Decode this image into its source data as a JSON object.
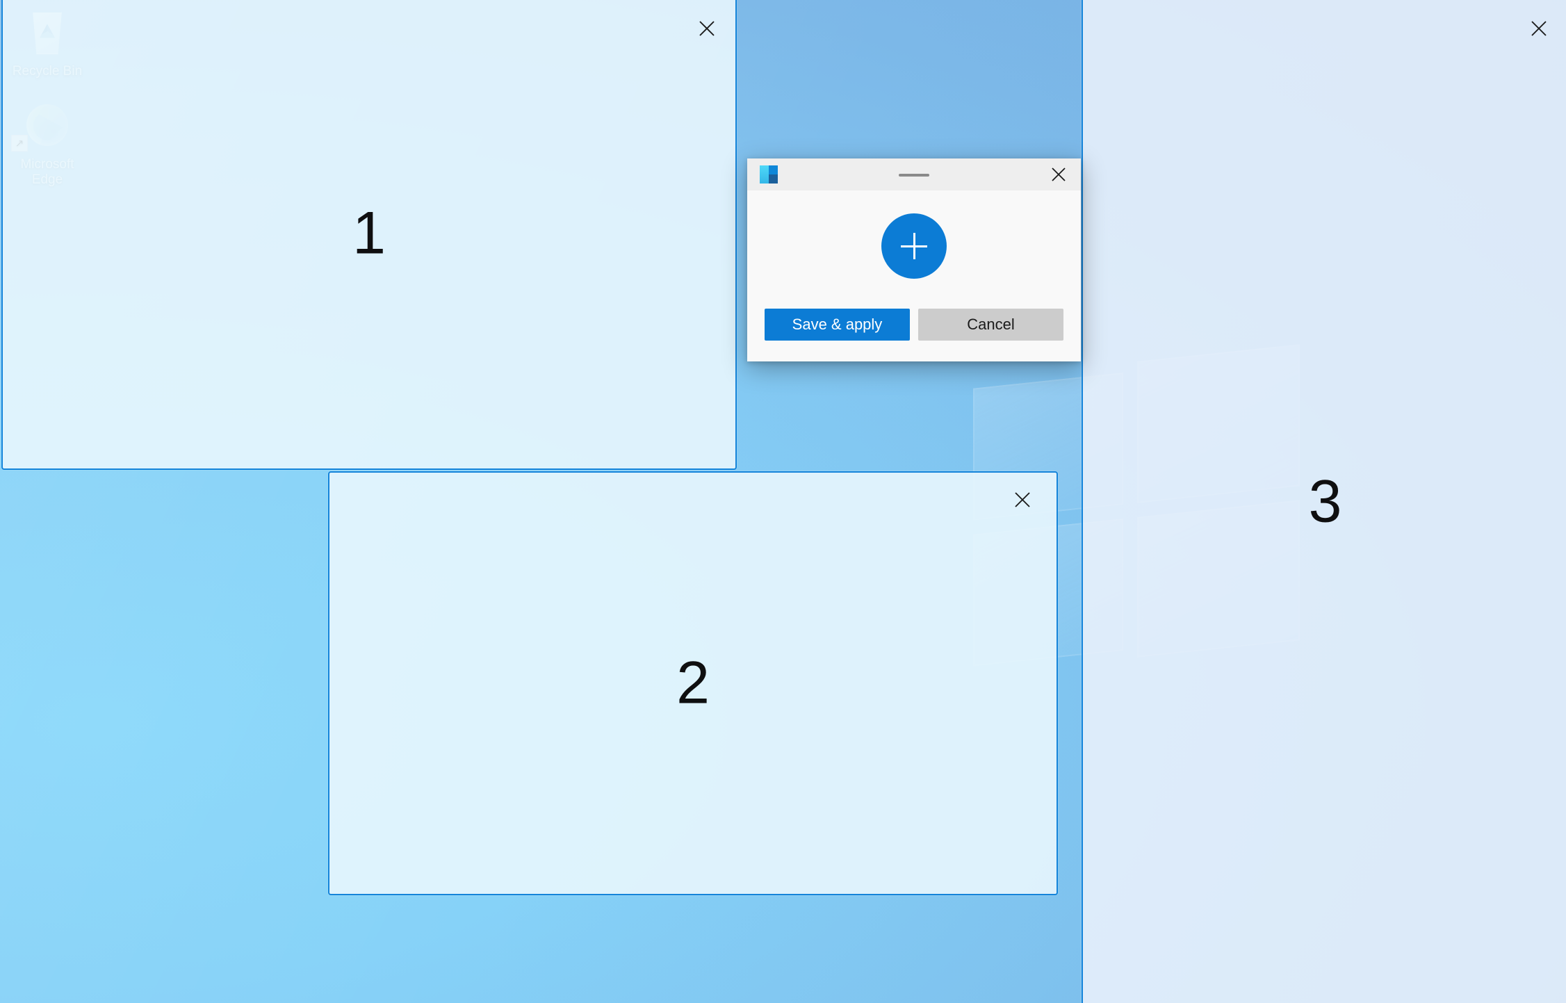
{
  "desktop": {
    "icons": [
      {
        "name": "Recycle Bin",
        "icon": "recycle-bin-icon"
      },
      {
        "name": "Microsoft Edge",
        "icon": "microsoft-edge-icon",
        "shortcut_glyph": "↗"
      }
    ]
  },
  "zones": {
    "accent_border_color": "#1484da",
    "items": [
      {
        "number": "1",
        "close_label": "✕"
      },
      {
        "number": "2",
        "close_label": "✕"
      },
      {
        "number": "3",
        "close_label": "✕"
      }
    ]
  },
  "editor": {
    "app_icon": "fancyzones-icon",
    "title": "",
    "drag_handle": "window-drag-handle",
    "close_label": "✕",
    "add_zone_label": "+",
    "buttons": {
      "save_label": "Save & apply",
      "cancel_label": "Cancel"
    },
    "colors": {
      "accent": "#0c7cd5",
      "secondary": "#cccccc",
      "titlebar": "#eeeeee",
      "surface": "#f9f9f9"
    }
  }
}
